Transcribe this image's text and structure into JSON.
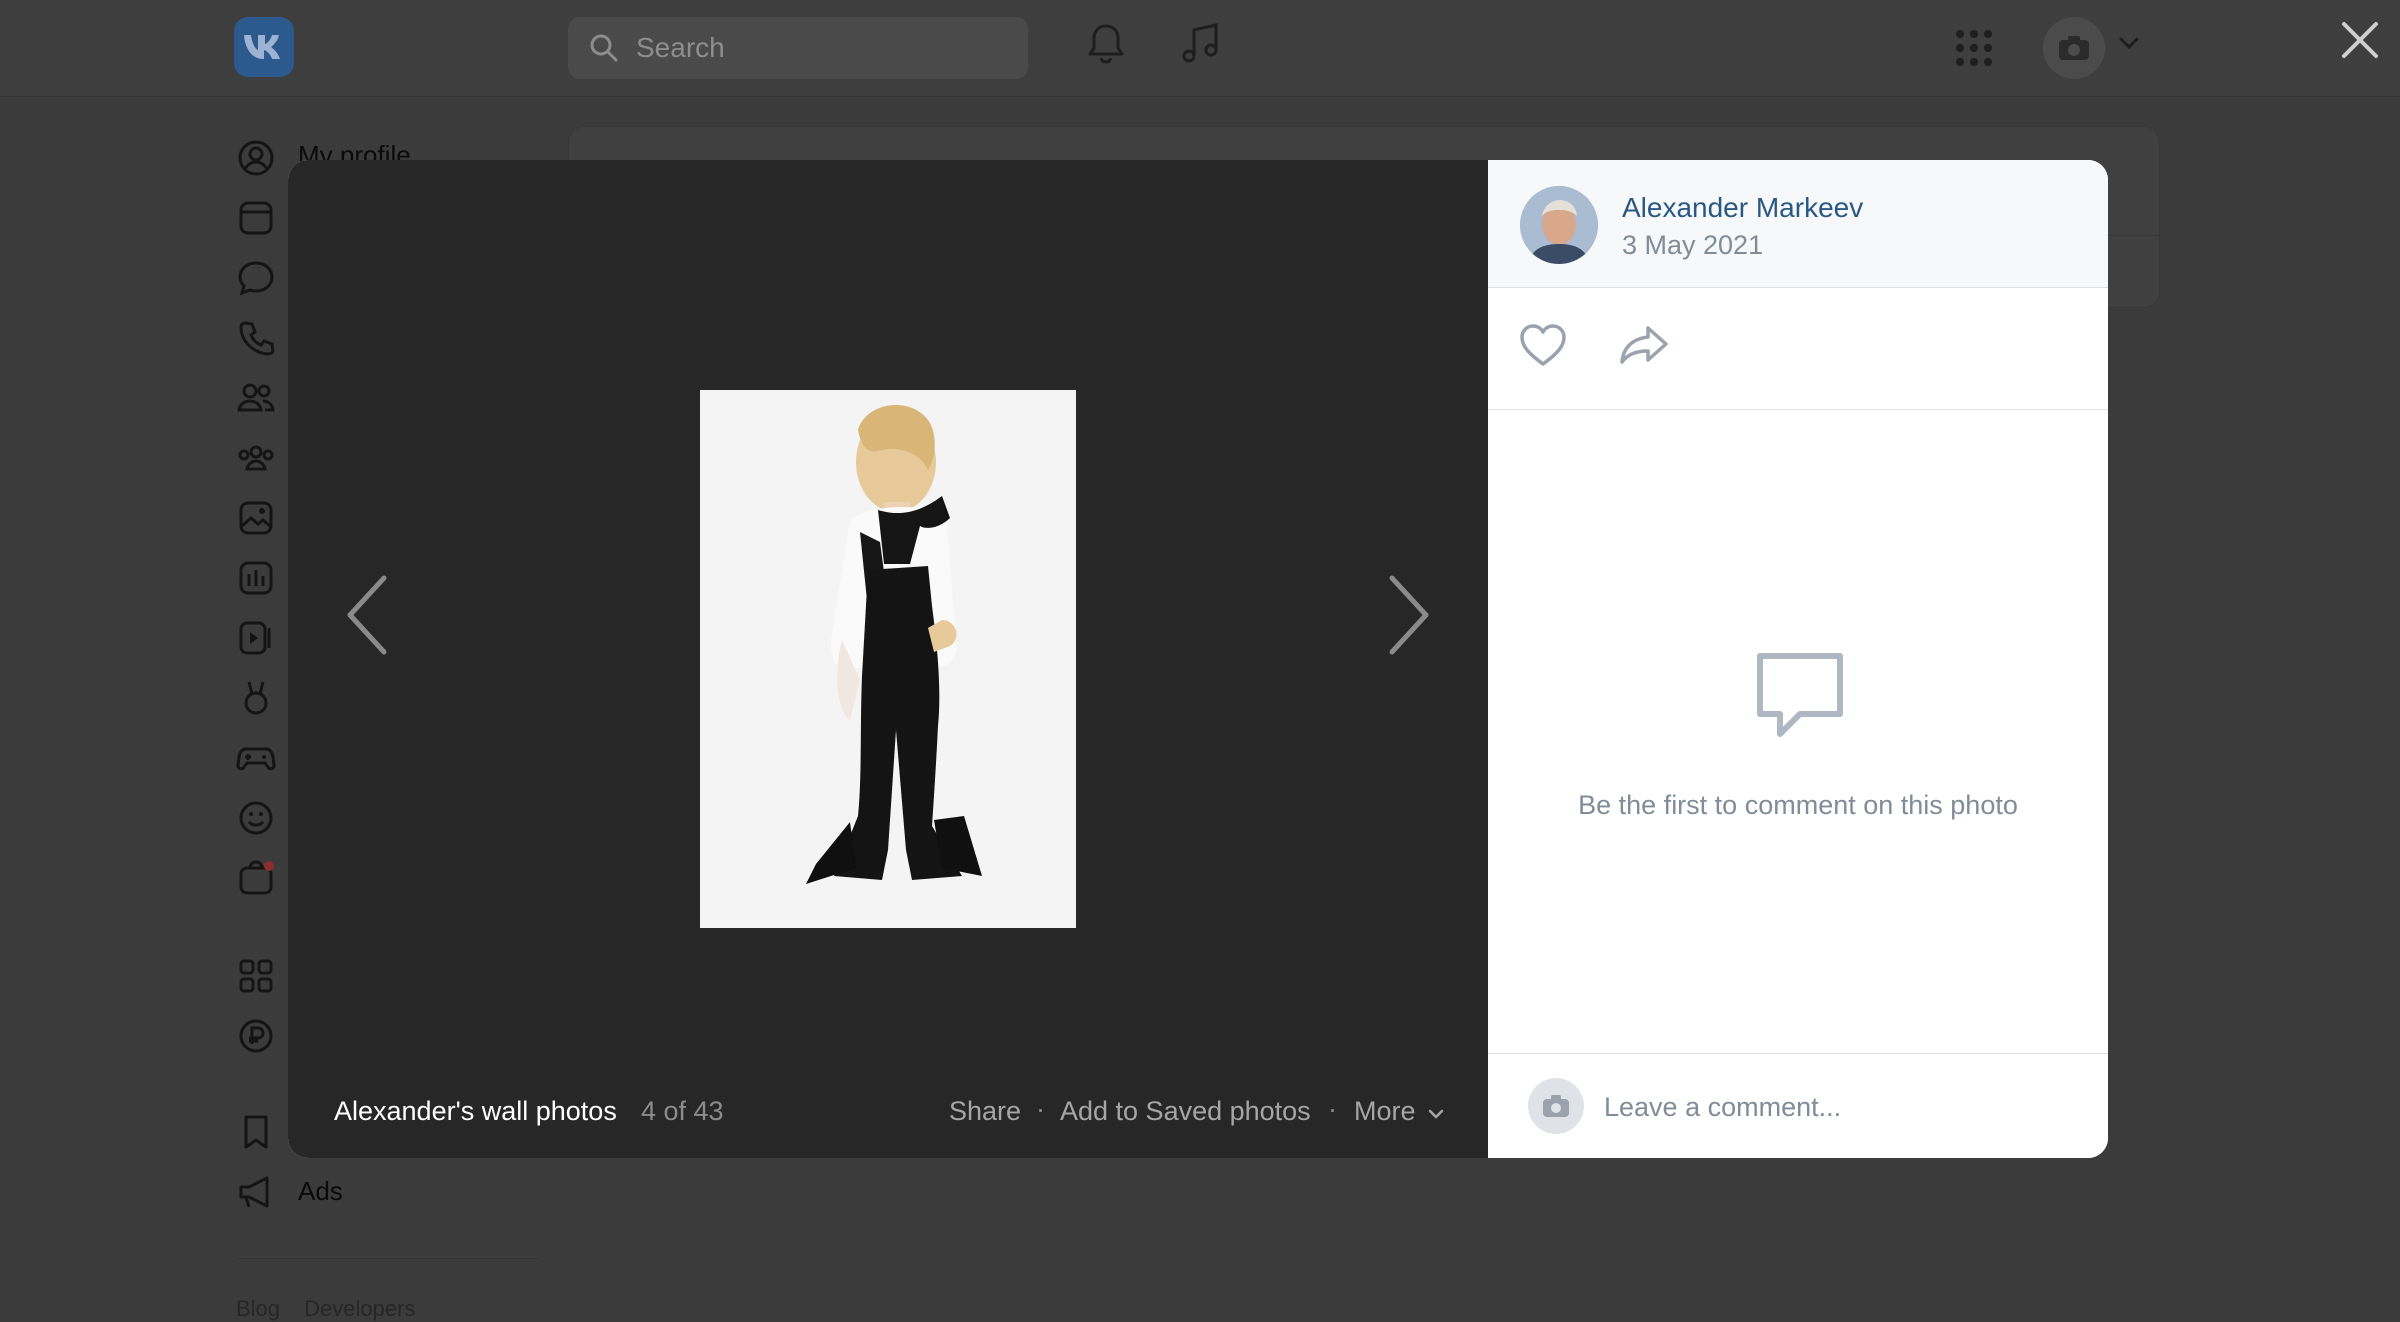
{
  "topbar": {
    "search_placeholder": "Search",
    "icons": [
      "vk-logo",
      "search-icon",
      "bell-icon",
      "music-icon",
      "apps-grid-icon",
      "avatar-camera-icon",
      "chevron-down-icon"
    ]
  },
  "sidebar": {
    "items": [
      {
        "icon": "profile-icon",
        "label": "My profile"
      },
      {
        "icon": "news-icon",
        "label": ""
      },
      {
        "icon": "messages-icon",
        "label": ""
      },
      {
        "icon": "calls-icon",
        "label": ""
      },
      {
        "icon": "friends-icon",
        "label": ""
      },
      {
        "icon": "communities-icon",
        "label": ""
      },
      {
        "icon": "photos-icon",
        "label": ""
      },
      {
        "icon": "music-icon",
        "label": ""
      },
      {
        "icon": "videos-icon",
        "label": ""
      },
      {
        "icon": "clips-icon",
        "label": ""
      },
      {
        "icon": "games-icon",
        "label": ""
      },
      {
        "icon": "stickers-icon",
        "label": ""
      },
      {
        "icon": "market-icon",
        "label": ""
      },
      {
        "icon": "services-icon",
        "label": ""
      },
      {
        "icon": "payments-icon",
        "label": ""
      },
      {
        "icon": "bookmarks-icon",
        "label": ""
      },
      {
        "icon": "ads-icon",
        "label": "Ads"
      }
    ],
    "footer": {
      "blog": "Blog",
      "developers": "Developers"
    }
  },
  "viewer": {
    "album_name": "Alexander's wall photos",
    "counter": "4 of 43",
    "actions": {
      "share": "Share",
      "save": "Add to Saved photos",
      "more": "More"
    },
    "separator": "·"
  },
  "post": {
    "author": "Alexander Markeev",
    "date": "3 May 2021",
    "empty_comments": "Be the first to comment on this photo",
    "comment_placeholder": "Leave a comment..."
  },
  "colors": {
    "link": "#2a5885",
    "secondary_text": "#818c99",
    "viewer_bg": "#272727",
    "overlay_bg": "#3b3b3b"
  }
}
